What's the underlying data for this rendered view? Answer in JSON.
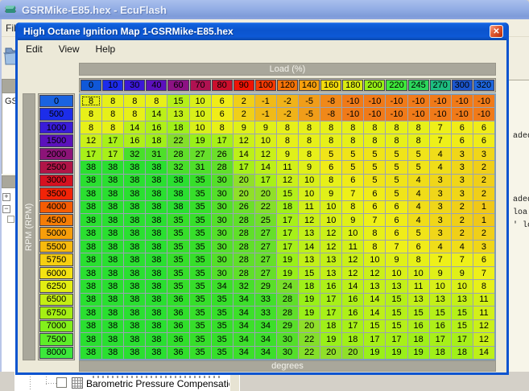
{
  "main_window": {
    "title": "GSRMike-E85.hex - EcuFlash",
    "menu": [
      "File"
    ],
    "left_panel_text": "GS",
    "tree_bottom_item": "Barometric Pressure Compensation",
    "log_fragments": [
      "aded",
      "aded",
      "loa",
      "' lo"
    ]
  },
  "dialog": {
    "title": "High Octane Ignition Map 1-GSRMike-E85.hex",
    "menu": [
      "Edit",
      "View",
      "Help"
    ],
    "x_axis_title": "Load (%)",
    "y_axis_title": "RPM (RPM)",
    "unit_label": "degrees"
  },
  "icons": {
    "close": "✕",
    "tree_expand": "+",
    "tree_collapse": "−"
  },
  "colors": {
    "dialog_titlebar": "#0c54cf",
    "close_button": "#d6492a",
    "axis_band": "#a9a79b",
    "main_titlebar_inactive": "#93aee5",
    "client_bg": "#ece9d8"
  },
  "chart_data": {
    "type": "heatmap",
    "title": "High Octane Ignition Map 1",
    "xlabel": "Load (%)",
    "ylabel": "RPM (RPM)",
    "unit": "degrees",
    "x_categories": [
      0,
      10,
      30,
      40,
      60,
      70,
      80,
      90,
      100,
      120,
      140,
      160,
      180,
      200,
      220,
      245,
      270,
      300,
      320
    ],
    "y_categories": [
      0,
      500,
      1000,
      1500,
      2000,
      2500,
      3000,
      3500,
      4000,
      4500,
      5000,
      5500,
      5750,
      6000,
      6250,
      6500,
      6750,
      7000,
      7500,
      8000
    ],
    "values": [
      [
        8,
        8,
        8,
        8,
        15,
        10,
        6,
        2,
        -1,
        -2,
        -5,
        -8,
        -10,
        -10,
        -10,
        -10,
        -10,
        -10,
        -10
      ],
      [
        8,
        8,
        8,
        14,
        13,
        10,
        6,
        2,
        -1,
        -2,
        -5,
        -8,
        -10,
        -10,
        -10,
        -10,
        -10,
        -10,
        -10
      ],
      [
        8,
        8,
        14,
        16,
        18,
        10,
        8,
        9,
        9,
        8,
        8,
        8,
        8,
        8,
        8,
        8,
        7,
        6,
        6
      ],
      [
        12,
        17,
        16,
        18,
        22,
        19,
        17,
        12,
        10,
        8,
        8,
        8,
        8,
        8,
        8,
        8,
        7,
        6,
        6
      ],
      [
        17,
        17,
        32,
        31,
        28,
        27,
        26,
        14,
        12,
        9,
        8,
        5,
        5,
        5,
        5,
        5,
        4,
        3,
        3
      ],
      [
        38,
        38,
        38,
        38,
        32,
        31,
        28,
        17,
        14,
        11,
        9,
        6,
        5,
        5,
        5,
        5,
        4,
        3,
        2
      ],
      [
        38,
        38,
        38,
        38,
        38,
        35,
        30,
        20,
        17,
        12,
        10,
        8,
        6,
        5,
        5,
        4,
        3,
        3,
        2
      ],
      [
        38,
        38,
        38,
        38,
        38,
        35,
        30,
        20,
        20,
        15,
        10,
        9,
        7,
        6,
        5,
        4,
        3,
        3,
        2
      ],
      [
        38,
        38,
        38,
        38,
        38,
        35,
        30,
        26,
        22,
        18,
        11,
        10,
        8,
        6,
        6,
        4,
        3,
        2,
        1
      ],
      [
        38,
        38,
        38,
        38,
        35,
        35,
        30,
        28,
        25,
        17,
        12,
        10,
        9,
        7,
        6,
        4,
        3,
        2,
        1
      ],
      [
        38,
        38,
        38,
        38,
        35,
        35,
        30,
        28,
        27,
        17,
        13,
        12,
        10,
        8,
        6,
        5,
        3,
        2,
        2
      ],
      [
        38,
        38,
        38,
        38,
        35,
        35,
        30,
        28,
        27,
        17,
        14,
        12,
        11,
        8,
        7,
        6,
        4,
        4,
        3
      ],
      [
        38,
        38,
        38,
        38,
        35,
        35,
        30,
        28,
        27,
        19,
        13,
        13,
        12,
        10,
        9,
        8,
        7,
        7,
        6
      ],
      [
        38,
        38,
        38,
        38,
        35,
        35,
        30,
        28,
        27,
        19,
        15,
        13,
        12,
        12,
        10,
        10,
        9,
        9,
        7
      ],
      [
        38,
        38,
        38,
        38,
        35,
        35,
        34,
        32,
        29,
        24,
        18,
        16,
        14,
        13,
        13,
        11,
        10,
        10,
        8
      ],
      [
        38,
        38,
        38,
        38,
        36,
        35,
        35,
        34,
        33,
        28,
        19,
        17,
        16,
        14,
        15,
        13,
        13,
        13,
        11
      ],
      [
        38,
        38,
        38,
        38,
        36,
        35,
        35,
        34,
        33,
        28,
        19,
        17,
        16,
        14,
        15,
        15,
        15,
        15,
        11
      ],
      [
        38,
        38,
        38,
        38,
        36,
        35,
        35,
        34,
        34,
        29,
        20,
        18,
        17,
        15,
        15,
        16,
        16,
        15,
        12
      ],
      [
        38,
        38,
        38,
        38,
        36,
        35,
        35,
        34,
        34,
        30,
        22,
        19,
        18,
        17,
        17,
        18,
        17,
        17,
        12
      ],
      [
        38,
        38,
        38,
        38,
        36,
        35,
        35,
        34,
        34,
        30,
        22,
        20,
        20,
        19,
        19,
        19,
        18,
        18,
        14
      ]
    ],
    "value_range": [
      -10,
      38
    ],
    "selected_cell": {
      "row": 0,
      "col": 0
    },
    "x_header_colors": [
      "#1058d8",
      "#1d2ceb",
      "#3b18d8",
      "#5c10bd",
      "#8d1284",
      "#b01251",
      "#cb0f2d",
      "#ee1406",
      "#f53a04",
      "#f57307",
      "#f9a00d",
      "#f2d90c",
      "#d8e912",
      "#97ef16",
      "#3fe83a",
      "#2bd65b",
      "#1dbd80",
      "#1c55cd",
      "#1e66dd"
    ],
    "y_header_colors": [
      "#1a63e0",
      "#1c2dea",
      "#3a1cd8",
      "#5b12bb",
      "#8c1478",
      "#b01547",
      "#d61120",
      "#f22408",
      "#f55c04",
      "#f57d06",
      "#f79e0a",
      "#f8ba0e",
      "#f6cf10",
      "#f4e312",
      "#e2ee13",
      "#c4ee14",
      "#a5ef14",
      "#83f01b",
      "#5eee28",
      "#3ce83b"
    ]
  }
}
